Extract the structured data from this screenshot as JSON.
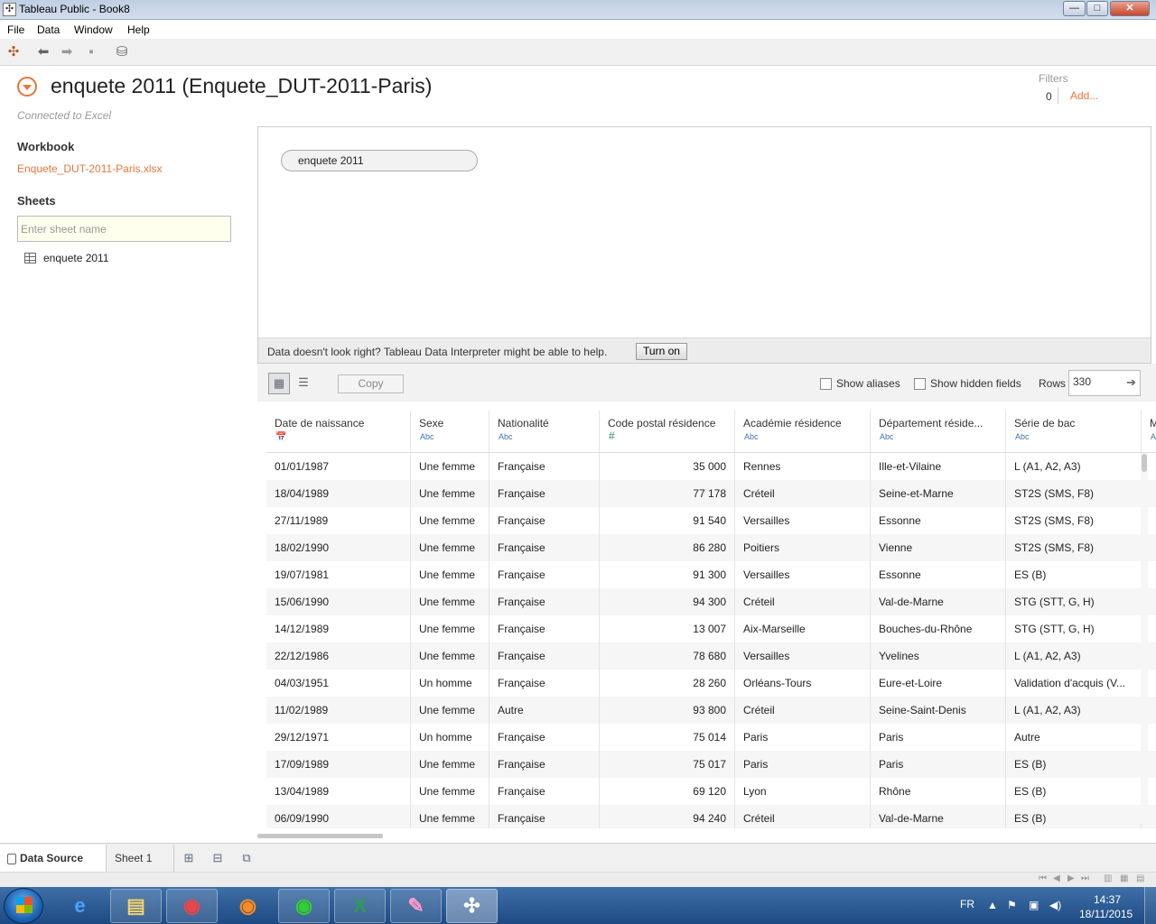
{
  "window": {
    "title": "Tableau Public - Book8",
    "minimize": "—",
    "maximize": "□",
    "close": "✕"
  },
  "menu": [
    "File",
    "Data",
    "Window",
    "Help"
  ],
  "datasource": {
    "title": "enquete 2011 (Enquete_DUT-2011-Paris)",
    "connection_status": "Connected to Excel",
    "filters": {
      "label": "Filters",
      "count": "0",
      "add": "Add..."
    }
  },
  "sidebar": {
    "workbook_heading": "Workbook",
    "workbook_file": "Enquete_DUT-2011-Paris.xlsx",
    "sheets_heading": "Sheets",
    "sheet_search_placeholder": "Enter sheet name",
    "sheets": [
      "enquete 2011"
    ]
  },
  "canvas": {
    "table_pill": "enquete 2011",
    "interpreter_message": "Data doesn't look right? Tableau Data Interpreter might be able to help.",
    "turn_on": "Turn on"
  },
  "grid_toolbar": {
    "copy": "Copy",
    "show_aliases": "Show aliases",
    "show_hidden_fields": "Show hidden fields",
    "rows_label": "Rows",
    "rows_value": "330"
  },
  "table": {
    "columns": [
      {
        "name": "Date de naissance",
        "type": "date"
      },
      {
        "name": "Sexe",
        "type": "Abc"
      },
      {
        "name": "Nationalité",
        "type": "Abc"
      },
      {
        "name": "Code postal résidence",
        "type": "#"
      },
      {
        "name": "Académie résidence",
        "type": "Abc"
      },
      {
        "name": "Département réside...",
        "type": "Abc"
      },
      {
        "name": "Série de bac",
        "type": "Abc"
      },
      {
        "name": "Me",
        "type": "Abc"
      }
    ],
    "rows": [
      [
        "01/01/1987",
        "Une femme",
        "Française",
        "35 000",
        "Rennes",
        "Ille-et-Vilaine",
        "L (A1, A2, A3)",
        ""
      ],
      [
        "18/04/1989",
        "Une femme",
        "Française",
        "77 178",
        "Créteil",
        "Seine-et-Marne",
        "ST2S (SMS, F8)",
        ""
      ],
      [
        "27/11/1989",
        "Une femme",
        "Française",
        "91 540",
        "Versailles",
        "Essonne",
        "ST2S (SMS, F8)",
        ""
      ],
      [
        "18/02/1990",
        "Une femme",
        "Française",
        "86 280",
        "Poitiers",
        "Vienne",
        "ST2S (SMS, F8)",
        ""
      ],
      [
        "19/07/1981",
        "Une femme",
        "Française",
        "91 300",
        "Versailles",
        "Essonne",
        "ES (B)",
        ""
      ],
      [
        "15/06/1990",
        "Une femme",
        "Française",
        "94 300",
        "Créteil",
        "Val-de-Marne",
        "STG (STT, G, H)",
        ""
      ],
      [
        "14/12/1989",
        "Une femme",
        "Française",
        "13 007",
        "Aix-Marseille",
        "Bouches-du-Rhône",
        "STG (STT, G, H)",
        ""
      ],
      [
        "22/12/1986",
        "Une femme",
        "Française",
        "78 680",
        "Versailles",
        "Yvelines",
        "L (A1, A2, A3)",
        ""
      ],
      [
        "04/03/1951",
        "Un homme",
        "Française",
        "28 260",
        "Orléans-Tours",
        "Eure-et-Loire",
        "Validation d'acquis (V...",
        ""
      ],
      [
        "11/02/1989",
        "Une femme",
        "Autre",
        "93 800",
        "Créteil",
        "Seine-Saint-Denis",
        "L (A1, A2, A3)",
        ""
      ],
      [
        "29/12/1971",
        "Un homme",
        "Française",
        "75 014",
        "Paris",
        "Paris",
        "Autre",
        ""
      ],
      [
        "17/09/1989",
        "Une femme",
        "Française",
        "75 017",
        "Paris",
        "Paris",
        "ES (B)",
        ""
      ],
      [
        "13/04/1989",
        "Une femme",
        "Française",
        "69 120",
        "Lyon",
        "Rhône",
        "ES (B)",
        ""
      ],
      [
        "06/09/1990",
        "Une femme",
        "Française",
        "94 240",
        "Créteil",
        "Val-de-Marne",
        "ES (B)",
        ""
      ]
    ]
  },
  "tabs": {
    "data_source": "Data Source",
    "sheet1": "Sheet 1"
  },
  "taskbar": {
    "language": "FR",
    "time": "14:37",
    "date": "18/11/2015"
  },
  "colors": {
    "accent": "#e8763a",
    "taskbar": "#2a5a94"
  }
}
